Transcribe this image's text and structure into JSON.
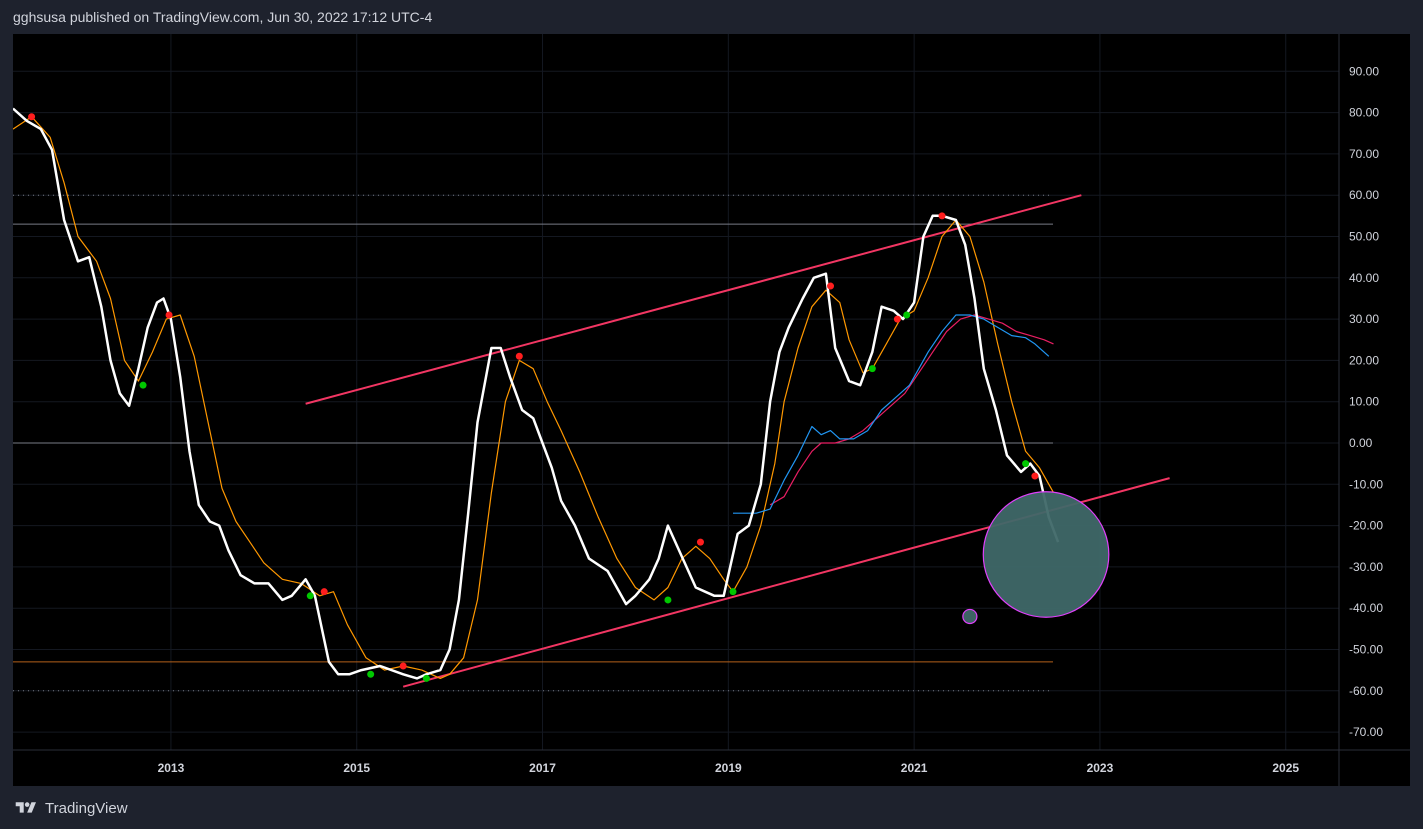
{
  "header": {
    "title": "gghsusa published on TradingView.com, Jun 30, 2022 17:12 UTC-4"
  },
  "footer": {
    "brand": "TradingView",
    "logo_icon": "tradingview-logo-icon"
  },
  "colors": {
    "background": "#000000",
    "panel": "#1e222d",
    "main_line": "#ffffff",
    "signal_line": "#ff9800",
    "blue_ma": "#2196f3",
    "red_ma": "#e91e63",
    "channel": "#f23663",
    "level_gray": "#787b86",
    "level_orange": "#b4601a",
    "bubble_fill": "#3f6868",
    "bubble_stroke": "#e040fb",
    "dot_up": "#00c800",
    "dot_down": "#ff1e1e"
  },
  "chart_data": {
    "type": "line",
    "y_axis_ticks": [
      "90.00",
      "80.00",
      "70.00",
      "60.00",
      "50.00",
      "40.00",
      "30.00",
      "20.00",
      "10.00",
      "0.00",
      "-10.00",
      "-20.00",
      "-30.00",
      "-40.00",
      "-50.00",
      "-60.00",
      "-70.00"
    ],
    "x_axis_ticks": [
      "2013",
      "2015",
      "2017",
      "2019",
      "2021",
      "2023",
      "2025"
    ],
    "x_tick_values": [
      2013,
      2015,
      2017,
      2019,
      2021,
      2023,
      2025
    ],
    "ylim": [
      -75,
      97
    ],
    "xlim": [
      2011.3,
      2025.6
    ],
    "grid": true,
    "horizontal_levels": [
      {
        "y": 60,
        "style": "dotted",
        "color": "gray"
      },
      {
        "y": 53,
        "style": "solid",
        "color": "gray"
      },
      {
        "y": 0,
        "style": "solid",
        "color": "gray"
      },
      {
        "y": -53,
        "style": "solid",
        "color": "orange"
      },
      {
        "y": -60,
        "style": "dotted",
        "color": "gray"
      }
    ],
    "channel_lines": [
      {
        "x1": 2014.45,
        "y1": 9.5,
        "x2": 2022.8,
        "y2": 60
      },
      {
        "x1": 2015.5,
        "y1": -59,
        "x2": 2023.75,
        "y2": -8.5
      }
    ],
    "series": [
      {
        "role": "main",
        "x": [
          2011.3,
          2011.45,
          2011.6,
          2011.72,
          2011.85,
          2012.0,
          2012.12,
          2012.25,
          2012.35,
          2012.45,
          2012.55,
          2012.65,
          2012.75,
          2012.85,
          2012.92,
          2013.0,
          2013.1,
          2013.2,
          2013.3,
          2013.42,
          2013.52,
          2013.62,
          2013.75,
          2013.9,
          2014.05,
          2014.2,
          2014.3,
          2014.45,
          2014.55,
          2014.7,
          2014.8,
          2014.92,
          2015.05,
          2015.25,
          2015.5,
          2015.65,
          2015.75,
          2015.9,
          2016.0,
          2016.1,
          2016.2,
          2016.3,
          2016.45,
          2016.55,
          2016.65,
          2016.78,
          2016.9,
          2017.0,
          2017.1,
          2017.2,
          2017.35,
          2017.5,
          2017.7,
          2017.9,
          2018.0,
          2018.15,
          2018.25,
          2018.35,
          2018.45,
          2018.55,
          2018.65,
          2018.75,
          2018.85,
          2018.95,
          2019.1,
          2019.22,
          2019.35,
          2019.45,
          2019.55,
          2019.65,
          2019.8,
          2019.92,
          2020.05,
          2020.15,
          2020.3,
          2020.42,
          2020.55,
          2020.65,
          2020.78,
          2020.88,
          2021.0,
          2021.1,
          2021.2,
          2021.3,
          2021.45,
          2021.55,
          2021.65,
          2021.75,
          2021.88,
          2022.0,
          2022.15,
          2022.25,
          2022.35,
          2022.45,
          2022.55
        ],
        "y": [
          81,
          78,
          76,
          71,
          54,
          44,
          45,
          33,
          20,
          12,
          9,
          18,
          28,
          34,
          35,
          30,
          16,
          -2,
          -15,
          -19,
          -20,
          -26,
          -32,
          -34,
          -34,
          -38,
          -37,
          -33,
          -37,
          -53,
          -56,
          -56,
          -55,
          -54,
          -56,
          -57,
          -56,
          -55,
          -50,
          -38,
          -17,
          5,
          23,
          23,
          16,
          8,
          6,
          0,
          -6,
          -14,
          -20,
          -28,
          -31,
          -39,
          -37,
          -33,
          -28,
          -20,
          -25,
          -30,
          -35,
          -36,
          -37,
          -37,
          -22,
          -20,
          -10,
          10,
          22,
          28,
          35,
          40,
          41,
          23,
          15,
          14,
          22,
          33,
          32,
          30,
          34,
          50,
          55,
          55,
          54,
          48,
          35,
          18,
          8,
          -3,
          -7,
          -5,
          -8,
          -18,
          -24
        ]
      },
      {
        "role": "signal",
        "x": [
          2011.3,
          2011.5,
          2011.7,
          2011.85,
          2012.0,
          2012.2,
          2012.35,
          2012.5,
          2012.65,
          2012.8,
          2012.95,
          2013.1,
          2013.25,
          2013.4,
          2013.55,
          2013.7,
          2013.85,
          2014.0,
          2014.2,
          2014.4,
          2014.6,
          2014.75,
          2014.9,
          2015.1,
          2015.3,
          2015.5,
          2015.7,
          2015.9,
          2016.0,
          2016.15,
          2016.3,
          2016.45,
          2016.6,
          2016.75,
          2016.9,
          2017.05,
          2017.2,
          2017.4,
          2017.6,
          2017.8,
          2018.0,
          2018.2,
          2018.35,
          2018.5,
          2018.65,
          2018.8,
          2018.95,
          2019.05,
          2019.2,
          2019.35,
          2019.5,
          2019.6,
          2019.75,
          2019.9,
          2020.05,
          2020.2,
          2020.3,
          2020.45,
          2020.55,
          2020.7,
          2020.85,
          2021.0,
          2021.15,
          2021.3,
          2021.45,
          2021.6,
          2021.75,
          2021.9,
          2022.05,
          2022.2,
          2022.35,
          2022.5
        ],
        "y": [
          76,
          79,
          74,
          63,
          50,
          44,
          35,
          20,
          15,
          22,
          30,
          31,
          21,
          5,
          -11,
          -19,
          -24,
          -29,
          -33,
          -34,
          -37,
          -36,
          -44,
          -52,
          -55,
          -54,
          -55,
          -57,
          -56,
          -52,
          -38,
          -12,
          10,
          20,
          18,
          10,
          3,
          -7,
          -18,
          -28,
          -35,
          -38,
          -35,
          -28,
          -25,
          -28,
          -33,
          -36,
          -30,
          -20,
          -5,
          10,
          23,
          33,
          37,
          34,
          25,
          17,
          18,
          24,
          30,
          32,
          40,
          50,
          54,
          50,
          39,
          24,
          10,
          -2,
          -6,
          -12
        ]
      },
      {
        "role": "blue_ma",
        "x": [
          2019.05,
          2019.2,
          2019.3,
          2019.45,
          2019.6,
          2019.75,
          2019.9,
          2020.0,
          2020.1,
          2020.2,
          2020.35,
          2020.5,
          2020.65,
          2020.8,
          2020.95,
          2021.05,
          2021.15,
          2021.3,
          2021.45,
          2021.6,
          2021.75,
          2021.9,
          2022.05,
          2022.2,
          2022.3,
          2022.45
        ],
        "y": [
          -17,
          -17,
          -17,
          -16,
          -9,
          -3,
          4,
          2,
          3,
          1,
          1,
          3,
          8,
          11,
          14,
          18,
          22,
          27,
          31,
          31,
          30,
          28,
          26,
          25.5,
          24,
          21
        ]
      },
      {
        "role": "red_ma",
        "x": [
          2019.45,
          2019.6,
          2019.75,
          2019.9,
          2020.0,
          2020.15,
          2020.3,
          2020.45,
          2020.6,
          2020.75,
          2020.9,
          2021.05,
          2021.2,
          2021.35,
          2021.5,
          2021.65,
          2021.8,
          2021.95,
          2022.1,
          2022.25,
          2022.4,
          2022.5
        ],
        "y": [
          -15,
          -13,
          -7,
          -2,
          0,
          0,
          1,
          3,
          6,
          9,
          12,
          17,
          22,
          27,
          30,
          31,
          30,
          29,
          27,
          26,
          25,
          24
        ]
      }
    ],
    "markers_up": [
      [
        2012.7,
        14
      ],
      [
        2014.5,
        -37
      ],
      [
        2015.15,
        -56
      ],
      [
        2015.75,
        -57
      ],
      [
        2018.35,
        -38
      ],
      [
        2019.05,
        -36
      ],
      [
        2020.55,
        18
      ],
      [
        2020.92,
        31
      ],
      [
        2022.2,
        -5
      ]
    ],
    "markers_down": [
      [
        2011.5,
        79
      ],
      [
        2012.98,
        31
      ],
      [
        2014.65,
        -36
      ],
      [
        2015.5,
        -54
      ],
      [
        2016.75,
        21
      ],
      [
        2018.7,
        -24
      ],
      [
        2020.1,
        38
      ],
      [
        2020.82,
        30
      ],
      [
        2021.3,
        55
      ],
      [
        2022.3,
        -8
      ]
    ],
    "circles": [
      {
        "x": 2022.42,
        "y": -27,
        "r": 15.2,
        "kind": "large"
      },
      {
        "x": 2021.6,
        "y": -42,
        "r": 1.7,
        "kind": "small"
      }
    ]
  }
}
